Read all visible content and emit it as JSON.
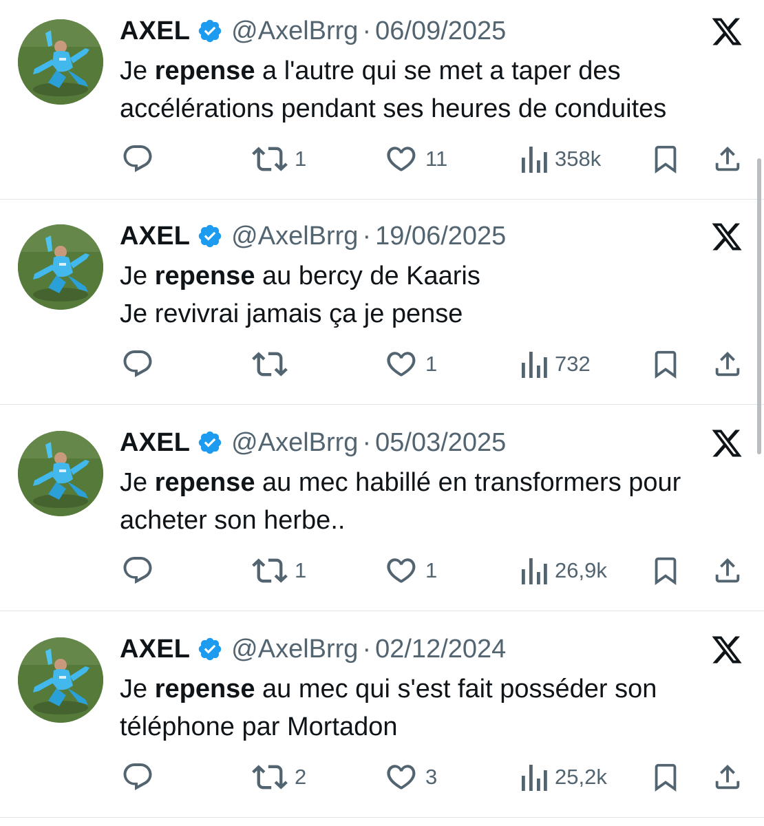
{
  "author": {
    "name": "AXEL",
    "handle": "@AxelBrrg",
    "separator": "·"
  },
  "icons": {
    "verified": "verified-badge-icon",
    "platform": "x-logo-icon",
    "reply": "reply-icon",
    "retweet": "retweet-icon",
    "like": "heart-icon",
    "views": "views-icon",
    "bookmark": "bookmark-icon",
    "share": "share-icon"
  },
  "colors": {
    "verified": "#1d9bf0",
    "text": "#0f1419",
    "secondary": "#536471",
    "divider": "#e1e3e6"
  },
  "tweets": [
    {
      "date": "06/09/2025",
      "lines": [
        {
          "pre": "Je ",
          "bold": "repense",
          "post": " a l'autre qui se met a taper des"
        },
        {
          "pre": "accélérations pendant ses heures de conduites",
          "bold": "",
          "post": ""
        }
      ],
      "retweets": "1",
      "likes": "11",
      "views": "358k"
    },
    {
      "date": "19/06/2025",
      "lines": [
        {
          "pre": "Je ",
          "bold": "repense",
          "post": " au bercy de Kaaris"
        },
        {
          "pre": "Je revivrai jamais ça je pense",
          "bold": "",
          "post": ""
        }
      ],
      "retweets": "",
      "likes": "1",
      "views": "732"
    },
    {
      "date": "05/03/2025",
      "lines": [
        {
          "pre": "Je ",
          "bold": "repense",
          "post": " au mec habillé en transformers pour"
        },
        {
          "pre": "acheter son herbe..",
          "bold": "",
          "post": ""
        }
      ],
      "retweets": "1",
      "likes": "1",
      "views": "26,9k"
    },
    {
      "date": "02/12/2024",
      "lines": [
        {
          "pre": "Je ",
          "bold": "repense",
          "post": " au mec qui s'est fait posséder son"
        },
        {
          "pre": "téléphone par Mortadon",
          "bold": "",
          "post": ""
        }
      ],
      "retweets": "2",
      "likes": "3",
      "views": "25,2k"
    }
  ]
}
